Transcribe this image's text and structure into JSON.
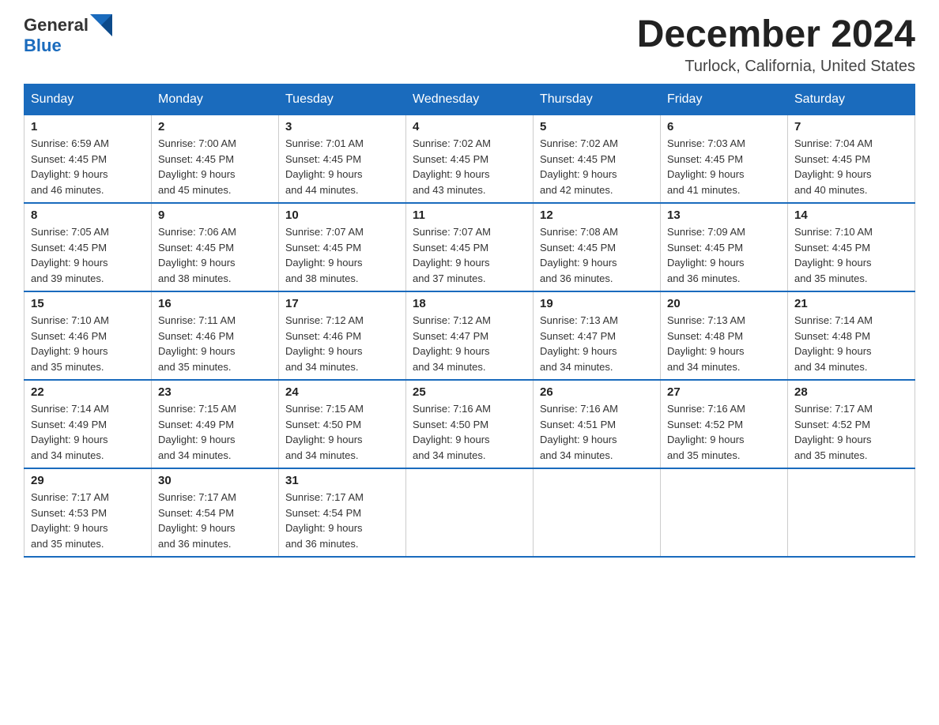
{
  "header": {
    "logo_text_general": "General",
    "logo_text_blue": "Blue",
    "month_title": "December 2024",
    "location": "Turlock, California, United States"
  },
  "days_of_week": [
    "Sunday",
    "Monday",
    "Tuesday",
    "Wednesday",
    "Thursday",
    "Friday",
    "Saturday"
  ],
  "weeks": [
    [
      {
        "day": "1",
        "sunrise": "6:59 AM",
        "sunset": "4:45 PM",
        "daylight": "9 hours and 46 minutes."
      },
      {
        "day": "2",
        "sunrise": "7:00 AM",
        "sunset": "4:45 PM",
        "daylight": "9 hours and 45 minutes."
      },
      {
        "day": "3",
        "sunrise": "7:01 AM",
        "sunset": "4:45 PM",
        "daylight": "9 hours and 44 minutes."
      },
      {
        "day": "4",
        "sunrise": "7:02 AM",
        "sunset": "4:45 PM",
        "daylight": "9 hours and 43 minutes."
      },
      {
        "day": "5",
        "sunrise": "7:02 AM",
        "sunset": "4:45 PM",
        "daylight": "9 hours and 42 minutes."
      },
      {
        "day": "6",
        "sunrise": "7:03 AM",
        "sunset": "4:45 PM",
        "daylight": "9 hours and 41 minutes."
      },
      {
        "day": "7",
        "sunrise": "7:04 AM",
        "sunset": "4:45 PM",
        "daylight": "9 hours and 40 minutes."
      }
    ],
    [
      {
        "day": "8",
        "sunrise": "7:05 AM",
        "sunset": "4:45 PM",
        "daylight": "9 hours and 39 minutes."
      },
      {
        "day": "9",
        "sunrise": "7:06 AM",
        "sunset": "4:45 PM",
        "daylight": "9 hours and 38 minutes."
      },
      {
        "day": "10",
        "sunrise": "7:07 AM",
        "sunset": "4:45 PM",
        "daylight": "9 hours and 38 minutes."
      },
      {
        "day": "11",
        "sunrise": "7:07 AM",
        "sunset": "4:45 PM",
        "daylight": "9 hours and 37 minutes."
      },
      {
        "day": "12",
        "sunrise": "7:08 AM",
        "sunset": "4:45 PM",
        "daylight": "9 hours and 36 minutes."
      },
      {
        "day": "13",
        "sunrise": "7:09 AM",
        "sunset": "4:45 PM",
        "daylight": "9 hours and 36 minutes."
      },
      {
        "day": "14",
        "sunrise": "7:10 AM",
        "sunset": "4:45 PM",
        "daylight": "9 hours and 35 minutes."
      }
    ],
    [
      {
        "day": "15",
        "sunrise": "7:10 AM",
        "sunset": "4:46 PM",
        "daylight": "9 hours and 35 minutes."
      },
      {
        "day": "16",
        "sunrise": "7:11 AM",
        "sunset": "4:46 PM",
        "daylight": "9 hours and 35 minutes."
      },
      {
        "day": "17",
        "sunrise": "7:12 AM",
        "sunset": "4:46 PM",
        "daylight": "9 hours and 34 minutes."
      },
      {
        "day": "18",
        "sunrise": "7:12 AM",
        "sunset": "4:47 PM",
        "daylight": "9 hours and 34 minutes."
      },
      {
        "day": "19",
        "sunrise": "7:13 AM",
        "sunset": "4:47 PM",
        "daylight": "9 hours and 34 minutes."
      },
      {
        "day": "20",
        "sunrise": "7:13 AM",
        "sunset": "4:48 PM",
        "daylight": "9 hours and 34 minutes."
      },
      {
        "day": "21",
        "sunrise": "7:14 AM",
        "sunset": "4:48 PM",
        "daylight": "9 hours and 34 minutes."
      }
    ],
    [
      {
        "day": "22",
        "sunrise": "7:14 AM",
        "sunset": "4:49 PM",
        "daylight": "9 hours and 34 minutes."
      },
      {
        "day": "23",
        "sunrise": "7:15 AM",
        "sunset": "4:49 PM",
        "daylight": "9 hours and 34 minutes."
      },
      {
        "day": "24",
        "sunrise": "7:15 AM",
        "sunset": "4:50 PM",
        "daylight": "9 hours and 34 minutes."
      },
      {
        "day": "25",
        "sunrise": "7:16 AM",
        "sunset": "4:50 PM",
        "daylight": "9 hours and 34 minutes."
      },
      {
        "day": "26",
        "sunrise": "7:16 AM",
        "sunset": "4:51 PM",
        "daylight": "9 hours and 34 minutes."
      },
      {
        "day": "27",
        "sunrise": "7:16 AM",
        "sunset": "4:52 PM",
        "daylight": "9 hours and 35 minutes."
      },
      {
        "day": "28",
        "sunrise": "7:17 AM",
        "sunset": "4:52 PM",
        "daylight": "9 hours and 35 minutes."
      }
    ],
    [
      {
        "day": "29",
        "sunrise": "7:17 AM",
        "sunset": "4:53 PM",
        "daylight": "9 hours and 35 minutes."
      },
      {
        "day": "30",
        "sunrise": "7:17 AM",
        "sunset": "4:54 PM",
        "daylight": "9 hours and 36 minutes."
      },
      {
        "day": "31",
        "sunrise": "7:17 AM",
        "sunset": "4:54 PM",
        "daylight": "9 hours and 36 minutes."
      },
      null,
      null,
      null,
      null
    ]
  ],
  "labels": {
    "sunrise": "Sunrise: ",
    "sunset": "Sunset: ",
    "daylight": "Daylight: "
  }
}
